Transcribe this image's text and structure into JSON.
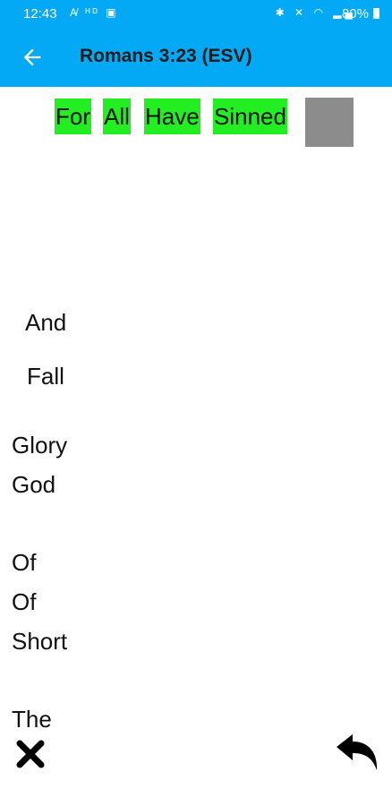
{
  "status_bar": {
    "time": "12:43",
    "left_icons": [
      "font-size-icon",
      "hd-icon",
      "image-icon"
    ],
    "right_icons": [
      "bluetooth-icon",
      "mute-icon",
      "wifi-icon",
      "signal-icon"
    ],
    "battery_percent": "80%"
  },
  "header": {
    "title": "Romans 3:23 (ESV)",
    "back_icon": "arrow-left-icon"
  },
  "selected_words": [
    "For",
    "All",
    "Have",
    "Sinned"
  ],
  "scrambled_words": [
    "And",
    "Fall",
    "Glory",
    "God",
    "Of",
    "Of",
    "Short",
    "The"
  ],
  "colors": {
    "app_bar": "#03a9f4",
    "chip": "#22ee22",
    "placeholder": "#8c8c8c"
  },
  "footer": {
    "close_icon": "close-icon",
    "undo_icon": "undo-icon"
  }
}
